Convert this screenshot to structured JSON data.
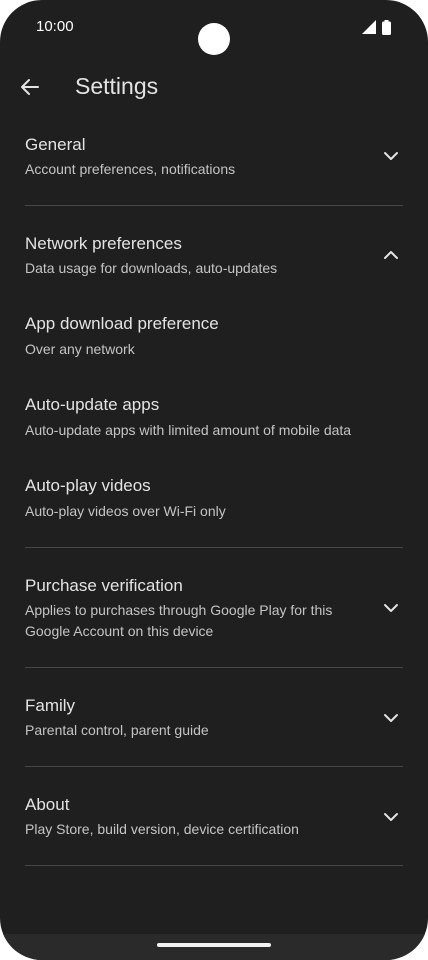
{
  "status_bar": {
    "time": "10:00",
    "icons": [
      "signal-icon",
      "battery-icon"
    ]
  },
  "app_bar": {
    "title": "Settings",
    "back_icon": "arrow-back-icon"
  },
  "sections": {
    "general": {
      "title": "General",
      "subtitle": "Account preferences, notifications",
      "expanded": false
    },
    "network": {
      "title": "Network preferences",
      "subtitle": "Data usage for downloads, auto-updates",
      "expanded": true,
      "items": [
        {
          "title": "App download preference",
          "subtitle": "Over any network"
        },
        {
          "title": "Auto-update apps",
          "subtitle": "Auto-update apps with limited amount of mobile data"
        },
        {
          "title": "Auto-play videos",
          "subtitle": "Auto-play videos over Wi-Fi only"
        }
      ]
    },
    "purchase": {
      "title": "Purchase verification",
      "subtitle": "Applies to purchases through Google Play for this Google Account on this device",
      "expanded": false
    },
    "family": {
      "title": "Family",
      "subtitle": "Parental control, parent guide",
      "expanded": false
    },
    "about": {
      "title": "About",
      "subtitle": "Play Store, build version, device certification",
      "expanded": false
    }
  },
  "colors": {
    "background": "#1f1f1f",
    "text_primary": "#e3e3e3",
    "text_secondary": "#c4c4c4",
    "divider": "#444746"
  }
}
